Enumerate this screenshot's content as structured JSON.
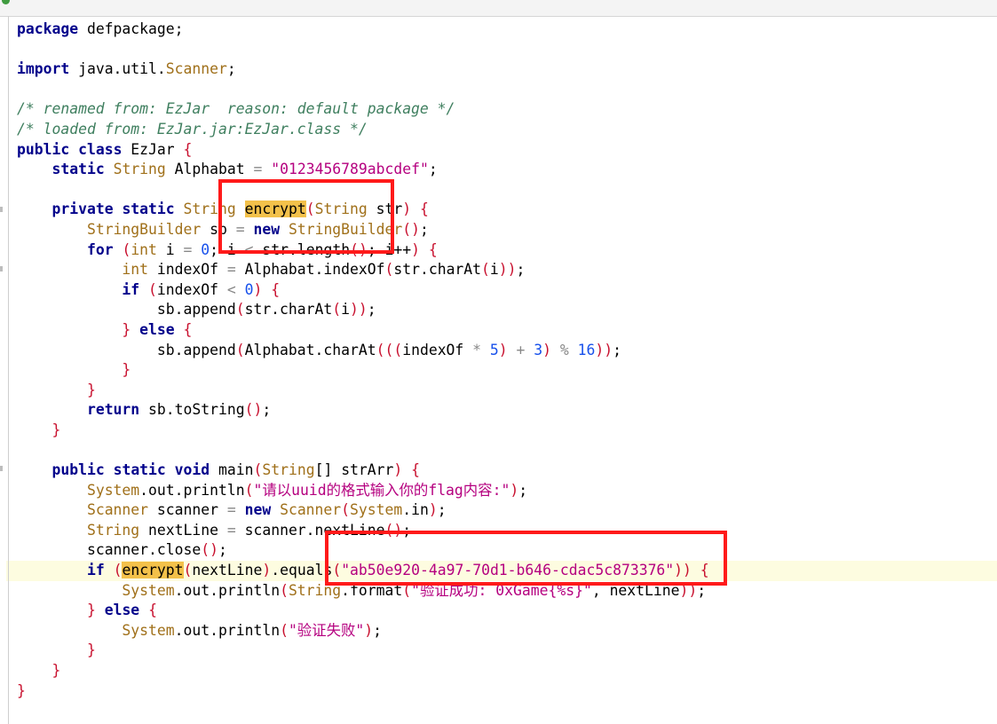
{
  "editor": {
    "lines": [
      [
        {
          "t": "package",
          "c": "kw"
        },
        {
          "t": " defpackage;",
          "c": ""
        }
      ],
      [],
      [
        {
          "t": "import",
          "c": "kw"
        },
        {
          "t": " java.util.",
          "c": ""
        },
        {
          "t": "Scanner",
          "c": "ty"
        },
        {
          "t": ";",
          "c": ""
        }
      ],
      [],
      [
        {
          "t": "/* renamed from: EzJar  reason: default package */",
          "c": "cm"
        }
      ],
      [
        {
          "t": "/* loaded from: EzJar.jar:EzJar.class */",
          "c": "cm"
        }
      ],
      [
        {
          "t": "public",
          "c": "kw"
        },
        {
          "t": " ",
          "c": ""
        },
        {
          "t": "class",
          "c": "kw"
        },
        {
          "t": " EzJar ",
          "c": ""
        },
        {
          "t": "{",
          "c": "pn"
        }
      ],
      [
        {
          "t": "    ",
          "c": ""
        },
        {
          "t": "static",
          "c": "kw"
        },
        {
          "t": " ",
          "c": ""
        },
        {
          "t": "String",
          "c": "ty"
        },
        {
          "t": " Alphabat ",
          "c": ""
        },
        {
          "t": "=",
          "c": "op"
        },
        {
          "t": " ",
          "c": ""
        },
        {
          "t": "\"0123456789abcdef\"",
          "c": "str"
        },
        {
          "t": ";",
          "c": ""
        }
      ],
      [],
      [
        {
          "t": "    ",
          "c": ""
        },
        {
          "t": "private",
          "c": "kw"
        },
        {
          "t": " ",
          "c": ""
        },
        {
          "t": "static",
          "c": "kw"
        },
        {
          "t": " ",
          "c": ""
        },
        {
          "t": "String",
          "c": "ty"
        },
        {
          "t": " ",
          "c": ""
        },
        {
          "t": "encrypt",
          "c": "occ"
        },
        {
          "t": "(",
          "c": "pn"
        },
        {
          "t": "String",
          "c": "ty"
        },
        {
          "t": " str",
          "c": ""
        },
        {
          "t": ")",
          "c": "pn"
        },
        {
          "t": " ",
          "c": ""
        },
        {
          "t": "{",
          "c": "pn"
        }
      ],
      [
        {
          "t": "        ",
          "c": ""
        },
        {
          "t": "StringBuilder",
          "c": "ty"
        },
        {
          "t": " sb ",
          "c": ""
        },
        {
          "t": "=",
          "c": "op"
        },
        {
          "t": " ",
          "c": ""
        },
        {
          "t": "new",
          "c": "kw"
        },
        {
          "t": " ",
          "c": ""
        },
        {
          "t": "StringBuilder",
          "c": "ty"
        },
        {
          "t": "()",
          "c": "pn"
        },
        {
          "t": ";",
          "c": ""
        }
      ],
      [
        {
          "t": "        ",
          "c": ""
        },
        {
          "t": "for",
          "c": "kw"
        },
        {
          "t": " ",
          "c": ""
        },
        {
          "t": "(",
          "c": "pn"
        },
        {
          "t": "int",
          "c": "ty"
        },
        {
          "t": " i ",
          "c": ""
        },
        {
          "t": "=",
          "c": "op"
        },
        {
          "t": " ",
          "c": ""
        },
        {
          "t": "0",
          "c": "num"
        },
        {
          "t": "; i ",
          "c": ""
        },
        {
          "t": "<",
          "c": "op"
        },
        {
          "t": " str.length",
          "c": ""
        },
        {
          "t": "()",
          "c": "pn"
        },
        {
          "t": "; i++",
          "c": ""
        },
        {
          "t": ")",
          "c": "pn"
        },
        {
          "t": " ",
          "c": ""
        },
        {
          "t": "{",
          "c": "pn"
        }
      ],
      [
        {
          "t": "            ",
          "c": ""
        },
        {
          "t": "int",
          "c": "ty"
        },
        {
          "t": " indexOf ",
          "c": ""
        },
        {
          "t": "=",
          "c": "op"
        },
        {
          "t": " Alphabat.indexOf",
          "c": ""
        },
        {
          "t": "(",
          "c": "pn"
        },
        {
          "t": "str.charAt",
          "c": ""
        },
        {
          "t": "(",
          "c": "pn"
        },
        {
          "t": "i",
          "c": ""
        },
        {
          "t": "))",
          "c": "pn"
        },
        {
          "t": ";",
          "c": ""
        }
      ],
      [
        {
          "t": "            ",
          "c": ""
        },
        {
          "t": "if",
          "c": "kw"
        },
        {
          "t": " ",
          "c": ""
        },
        {
          "t": "(",
          "c": "pn"
        },
        {
          "t": "indexOf ",
          "c": ""
        },
        {
          "t": "<",
          "c": "op"
        },
        {
          "t": " ",
          "c": ""
        },
        {
          "t": "0",
          "c": "num"
        },
        {
          "t": ")",
          "c": "pn"
        },
        {
          "t": " ",
          "c": ""
        },
        {
          "t": "{",
          "c": "pn"
        }
      ],
      [
        {
          "t": "                ",
          "c": ""
        },
        {
          "t": "sb.append",
          "c": ""
        },
        {
          "t": "(",
          "c": "pn"
        },
        {
          "t": "str.charAt",
          "c": ""
        },
        {
          "t": "(",
          "c": "pn"
        },
        {
          "t": "i",
          "c": ""
        },
        {
          "t": "))",
          "c": "pn"
        },
        {
          "t": ";",
          "c": ""
        }
      ],
      [
        {
          "t": "            ",
          "c": ""
        },
        {
          "t": "}",
          "c": "pn"
        },
        {
          "t": " ",
          "c": ""
        },
        {
          "t": "else",
          "c": "kw"
        },
        {
          "t": " ",
          "c": ""
        },
        {
          "t": "{",
          "c": "pn"
        }
      ],
      [
        {
          "t": "                ",
          "c": ""
        },
        {
          "t": "sb.append",
          "c": ""
        },
        {
          "t": "(",
          "c": "pn"
        },
        {
          "t": "Alphabat.charAt",
          "c": ""
        },
        {
          "t": "(((",
          "c": "pn"
        },
        {
          "t": "indexOf ",
          "c": ""
        },
        {
          "t": "*",
          "c": "op"
        },
        {
          "t": " ",
          "c": ""
        },
        {
          "t": "5",
          "c": "num"
        },
        {
          "t": ")",
          "c": "pn"
        },
        {
          "t": " ",
          "c": ""
        },
        {
          "t": "+",
          "c": "op"
        },
        {
          "t": " ",
          "c": ""
        },
        {
          "t": "3",
          "c": "num"
        },
        {
          "t": ")",
          "c": "pn"
        },
        {
          "t": " ",
          "c": ""
        },
        {
          "t": "%",
          "c": "op"
        },
        {
          "t": " ",
          "c": ""
        },
        {
          "t": "16",
          "c": "num"
        },
        {
          "t": "))",
          "c": "pn"
        },
        {
          "t": ";",
          "c": ""
        }
      ],
      [
        {
          "t": "            ",
          "c": ""
        },
        {
          "t": "}",
          "c": "pn"
        }
      ],
      [
        {
          "t": "        ",
          "c": ""
        },
        {
          "t": "}",
          "c": "pn"
        }
      ],
      [
        {
          "t": "        ",
          "c": ""
        },
        {
          "t": "return",
          "c": "kw"
        },
        {
          "t": " sb.toString",
          "c": ""
        },
        {
          "t": "()",
          "c": "pn"
        },
        {
          "t": ";",
          "c": ""
        }
      ],
      [
        {
          "t": "    ",
          "c": ""
        },
        {
          "t": "}",
          "c": "pn"
        }
      ],
      [],
      [
        {
          "t": "    ",
          "c": ""
        },
        {
          "t": "public",
          "c": "kw"
        },
        {
          "t": " ",
          "c": ""
        },
        {
          "t": "static",
          "c": "kw"
        },
        {
          "t": " ",
          "c": ""
        },
        {
          "t": "void",
          "c": "kw"
        },
        {
          "t": " main",
          "c": ""
        },
        {
          "t": "(",
          "c": "pn"
        },
        {
          "t": "String",
          "c": "ty"
        },
        {
          "t": "[] strArr",
          "c": ""
        },
        {
          "t": ")",
          "c": "pn"
        },
        {
          "t": " ",
          "c": ""
        },
        {
          "t": "{",
          "c": "pn"
        }
      ],
      [
        {
          "t": "        ",
          "c": ""
        },
        {
          "t": "System",
          "c": "ty"
        },
        {
          "t": ".out.println",
          "c": ""
        },
        {
          "t": "(",
          "c": "pn"
        },
        {
          "t": "\"请以uuid的格式输入你的flag内容:\"",
          "c": "str"
        },
        {
          "t": ")",
          "c": "pn"
        },
        {
          "t": ";",
          "c": ""
        }
      ],
      [
        {
          "t": "        ",
          "c": ""
        },
        {
          "t": "Scanner",
          "c": "ty"
        },
        {
          "t": " scanner ",
          "c": ""
        },
        {
          "t": "=",
          "c": "op"
        },
        {
          "t": " ",
          "c": ""
        },
        {
          "t": "new",
          "c": "kw"
        },
        {
          "t": " ",
          "c": ""
        },
        {
          "t": "Scanner",
          "c": "ty"
        },
        {
          "t": "(",
          "c": "pn"
        },
        {
          "t": "System",
          "c": "ty"
        },
        {
          "t": ".in",
          "c": ""
        },
        {
          "t": ")",
          "c": "pn"
        },
        {
          "t": ";",
          "c": ""
        }
      ],
      [
        {
          "t": "        ",
          "c": ""
        },
        {
          "t": "String",
          "c": "ty"
        },
        {
          "t": " nextLine ",
          "c": ""
        },
        {
          "t": "=",
          "c": "op"
        },
        {
          "t": " scanner.nextLine",
          "c": ""
        },
        {
          "t": "()",
          "c": "pn"
        },
        {
          "t": ";",
          "c": ""
        }
      ],
      [
        {
          "t": "        ",
          "c": ""
        },
        {
          "t": "scanner.close",
          "c": ""
        },
        {
          "t": "()",
          "c": "pn"
        },
        {
          "t": ";",
          "c": ""
        }
      ],
      [
        {
          "t": "        ",
          "c": ""
        },
        {
          "t": "if",
          "c": "kw"
        },
        {
          "t": " ",
          "c": ""
        },
        {
          "t": "(",
          "c": "pn"
        },
        {
          "t": "encrypt",
          "c": "occ"
        },
        {
          "t": "(",
          "c": "pn"
        },
        {
          "t": "nextLine",
          "c": ""
        },
        {
          "t": ")",
          "c": "pn"
        },
        {
          "t": ".equals",
          "c": ""
        },
        {
          "t": "(",
          "c": "pn"
        },
        {
          "t": "\"ab50e920-4a97-70d1-b646-cdac5c873376\"",
          "c": "str"
        },
        {
          "t": "))",
          "c": "pn"
        },
        {
          "t": " ",
          "c": ""
        },
        {
          "t": "{",
          "c": "pn"
        }
      ],
      [
        {
          "t": "            ",
          "c": ""
        },
        {
          "t": "System",
          "c": "ty"
        },
        {
          "t": ".out.println",
          "c": ""
        },
        {
          "t": "(",
          "c": "pn"
        },
        {
          "t": "String",
          "c": "ty"
        },
        {
          "t": ".format",
          "c": ""
        },
        {
          "t": "(",
          "c": "pn"
        },
        {
          "t": "\"验证成功: 0xGame{%s}\"",
          "c": "str"
        },
        {
          "t": ", nextLine",
          "c": ""
        },
        {
          "t": "))",
          "c": "pn"
        },
        {
          "t": ";",
          "c": ""
        }
      ],
      [
        {
          "t": "        ",
          "c": ""
        },
        {
          "t": "}",
          "c": "pn"
        },
        {
          "t": " ",
          "c": ""
        },
        {
          "t": "else",
          "c": "kw"
        },
        {
          "t": " ",
          "c": ""
        },
        {
          "t": "{",
          "c": "pn"
        }
      ],
      [
        {
          "t": "            ",
          "c": ""
        },
        {
          "t": "System",
          "c": "ty"
        },
        {
          "t": ".out.println",
          "c": ""
        },
        {
          "t": "(",
          "c": "pn"
        },
        {
          "t": "\"验证失败\"",
          "c": "str"
        },
        {
          "t": ")",
          "c": "pn"
        },
        {
          "t": ";",
          "c": ""
        }
      ],
      [
        {
          "t": "        ",
          "c": ""
        },
        {
          "t": "}",
          "c": "pn"
        }
      ],
      [
        {
          "t": "    ",
          "c": ""
        },
        {
          "t": "}",
          "c": "pn"
        }
      ],
      [
        {
          "t": "}",
          "c": "pn"
        }
      ]
    ],
    "current_line": 27
  },
  "colors": {
    "annotation_box": "#ff1a1a",
    "occurrence_highlight": "#f3c14a",
    "current_line": "#fdfce0"
  }
}
